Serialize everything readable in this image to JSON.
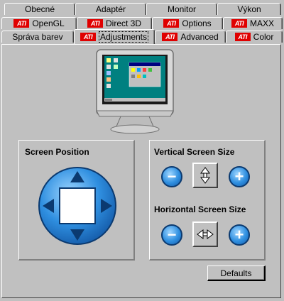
{
  "tabs": {
    "row1": [
      "Obecné",
      "Adaptér",
      "Monitor",
      "Výkon"
    ],
    "row2": [
      "OpenGL",
      "Direct 3D",
      "Options",
      "MAXX"
    ],
    "row3": [
      "Správa barev",
      "Adjustments",
      "Advanced",
      "Color"
    ],
    "active": "Adjustments",
    "ati_logo_text": "ATI"
  },
  "screen_position": {
    "label": "Screen Position",
    "up_icon": "arrow-up-icon",
    "down_icon": "arrow-down-icon",
    "left_icon": "arrow-left-icon",
    "right_icon": "arrow-right-icon"
  },
  "vertical_size": {
    "label": "Vertical Screen Size",
    "minus": "−",
    "plus": "+"
  },
  "horizontal_size": {
    "label": "Horizontal Screen Size",
    "minus": "−",
    "plus": "+"
  },
  "defaults_button": "Defaults",
  "colors": {
    "face": "#c0c0c0",
    "ati_red": "#e00000",
    "dpad_blue": "#2f8fe0",
    "monitor_screen": "#008080"
  }
}
